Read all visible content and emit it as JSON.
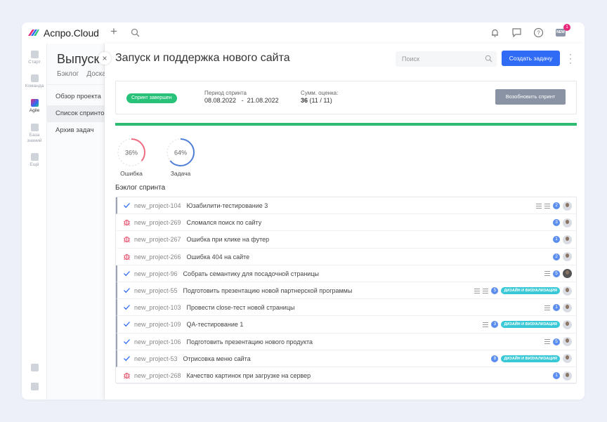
{
  "app": {
    "brand": "Аспро.Cloud",
    "new_badge": "NEW",
    "notif_count": "1"
  },
  "rail": [
    {
      "label": "Старт",
      "icon": "home-icon"
    },
    {
      "label": "Команда",
      "icon": "team-icon"
    },
    {
      "label": "Agile",
      "icon": "agile-icon"
    },
    {
      "label": "База знаний",
      "icon": "knowledge-icon"
    },
    {
      "label": "Ещё",
      "icon": "more-grid-icon"
    }
  ],
  "nav": {
    "title": "Выпуск новой",
    "tabs": [
      "Бэклог",
      "Доска"
    ],
    "items": [
      "Обзор проекта",
      "Список спринтов",
      "Архив задач"
    ]
  },
  "panel": {
    "title": "Запуск и поддержка нового сайта",
    "search_placeholder": "Поиск",
    "create_label": "Создать задачу"
  },
  "sprint": {
    "status": "Спринт завершен",
    "period_label": "Период спринта",
    "period_start": "08.08.2022",
    "period_sep": "-",
    "period_end": "21.08.2022",
    "sum_label": "Сумм. оценка:",
    "sum_value": "36",
    "sum_detail": "(11 / 11)",
    "reopen_label": "Возобновить спринт"
  },
  "stats": [
    {
      "percent": 36,
      "text": "36%",
      "label": "Ошибка",
      "color": "#ef6b7f"
    },
    {
      "percent": 64,
      "text": "64%",
      "label": "Задача",
      "color": "#4f7fd6"
    }
  ],
  "backlog_title": "Бэклог спринта",
  "rows": [
    {
      "type": "story",
      "key": "new_project-104",
      "name": "Юзабилити-тестирование 3",
      "pts": "2",
      "tag": "",
      "subtasks": true,
      "desc": true,
      "avatar": "light"
    },
    {
      "type": "bug",
      "key": "new_project-269",
      "name": "Сломался поиск по сайту",
      "pts": "3",
      "tag": "",
      "subtasks": false,
      "desc": false,
      "avatar": "light"
    },
    {
      "type": "bug",
      "key": "new_project-267",
      "name": "Ошибка при клике на футер",
      "pts": "1",
      "tag": "",
      "subtasks": false,
      "desc": false,
      "avatar": "light"
    },
    {
      "type": "bug",
      "key": "new_project-266",
      "name": "Ошибка 404 на сайте",
      "pts": "2",
      "tag": "",
      "subtasks": false,
      "desc": false,
      "avatar": "light"
    },
    {
      "type": "story",
      "key": "new_project-96",
      "name": "Собрать семантику для посадочной страницы",
      "pts": "5",
      "tag": "",
      "subtasks": false,
      "desc": true,
      "avatar": "dark"
    },
    {
      "type": "story",
      "key": "new_project-55",
      "name": "Подготовить презентацию новой партнерской программы",
      "pts": "5",
      "tag": "ДИЗАЙН И ВИЗУАЛИЗАЦИЯ",
      "subtasks": true,
      "desc": true,
      "avatar": "light"
    },
    {
      "type": "story",
      "key": "new_project-103",
      "name": "Провести close-тест новой страницы",
      "pts": "1",
      "tag": "",
      "subtasks": false,
      "desc": true,
      "avatar": "light"
    },
    {
      "type": "story",
      "key": "new_project-109",
      "name": "QA-тестирование 1",
      "pts": "3",
      "tag": "ДИЗАЙН И ВИЗУАЛИЗАЦИЯ",
      "subtasks": false,
      "desc": true,
      "avatar": "light"
    },
    {
      "type": "story",
      "key": "new_project-106",
      "name": "Подготовить презентацию нового продукта",
      "pts": "5",
      "tag": "",
      "subtasks": false,
      "desc": true,
      "avatar": "light"
    },
    {
      "type": "story",
      "key": "new_project-53",
      "name": "Отрисовка меню сайта",
      "pts": "8",
      "tag": "ДИЗАЙН И ВИЗУАЛИЗАЦИЯ",
      "subtasks": false,
      "desc": false,
      "avatar": "light"
    },
    {
      "type": "bug",
      "key": "new_project-268",
      "name": "Качество картинок при загрузке на сервер",
      "pts": "1",
      "tag": "",
      "subtasks": false,
      "desc": false,
      "avatar": "light"
    }
  ]
}
